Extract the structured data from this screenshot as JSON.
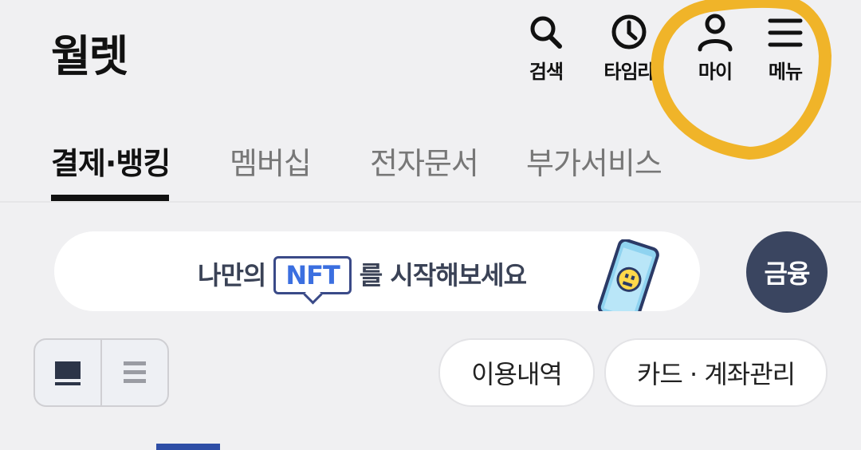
{
  "header": {
    "title": "월렛",
    "actions": [
      {
        "label": "검색",
        "icon": "search-icon"
      },
      {
        "label": "타임라",
        "icon": "clock-icon"
      },
      {
        "label": "마이",
        "icon": "person-icon"
      },
      {
        "label": "메뉴",
        "icon": "menu-icon"
      }
    ]
  },
  "tabs": [
    {
      "label": "결제·뱅킹",
      "active": true
    },
    {
      "label": "멤버십",
      "active": false
    },
    {
      "label": "전자문서",
      "active": false
    },
    {
      "label": "부가서비스",
      "active": false
    }
  ],
  "banner": {
    "text_before": "나만의",
    "badge": "NFT",
    "text_after": "를 시작해보세요"
  },
  "finance_button": "금융",
  "view_toggle": {
    "card_icon": "card-view-icon",
    "list_icon": "list-view-icon",
    "selected": "card"
  },
  "pills": {
    "usage_history": "이용내역",
    "card_account": "카드 · 계좌관리"
  },
  "colors": {
    "background": "#f0f0f2",
    "highlight_circle": "#f0b429",
    "finance_button": "#3a4560",
    "accent_blue": "#3b6fe0"
  }
}
